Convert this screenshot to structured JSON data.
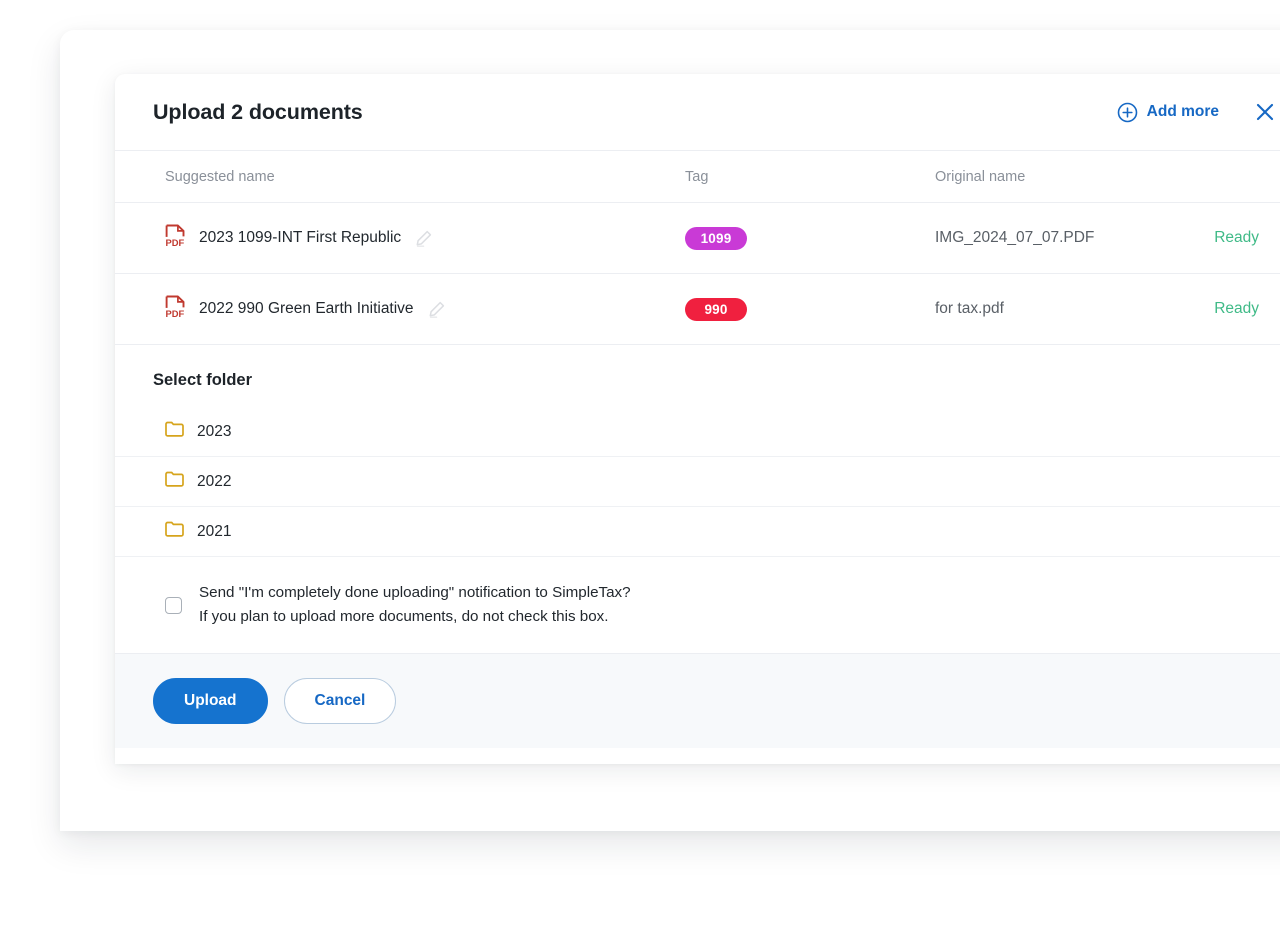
{
  "dialog": {
    "title": "Upload 2 documents",
    "add_more_label": "Add more",
    "add_more_icon": "plus-circle-icon",
    "close_icon": "close-icon"
  },
  "table": {
    "columns": {
      "name": "Suggested name",
      "tag": "Tag",
      "original": "Original name",
      "status": ""
    },
    "rows": [
      {
        "file_icon": "pdf-file-icon",
        "suggested_name": "2023 1099-INT First Republic",
        "edit_icon": "pencil-edit-icon",
        "tag": "1099",
        "tag_color": "#c93ad6",
        "original_name": "IMG_2024_07_07.PDF",
        "status": "Ready",
        "status_color": "#3fba87"
      },
      {
        "file_icon": "pdf-file-icon",
        "suggested_name": "2022 990 Green Earth Initiative",
        "edit_icon": "pencil-edit-icon",
        "tag": "990",
        "tag_color": "#f0203f",
        "original_name": "for tax.pdf",
        "status": "Ready",
        "status_color": "#3fba87"
      }
    ]
  },
  "folders": {
    "title": "Select folder",
    "icon": "folder-icon",
    "icon_color": "#d6a41c",
    "items": [
      {
        "label": "2023"
      },
      {
        "label": "2022"
      },
      {
        "label": "2021"
      }
    ]
  },
  "notification": {
    "checked": false,
    "line1": "Send \"I'm completely done uploading\" notification to SimpleTax?",
    "line2": "If you plan to upload more documents, do not check this box."
  },
  "footer": {
    "upload_label": "Upload",
    "cancel_label": "Cancel",
    "primary_color": "#1573cf"
  }
}
